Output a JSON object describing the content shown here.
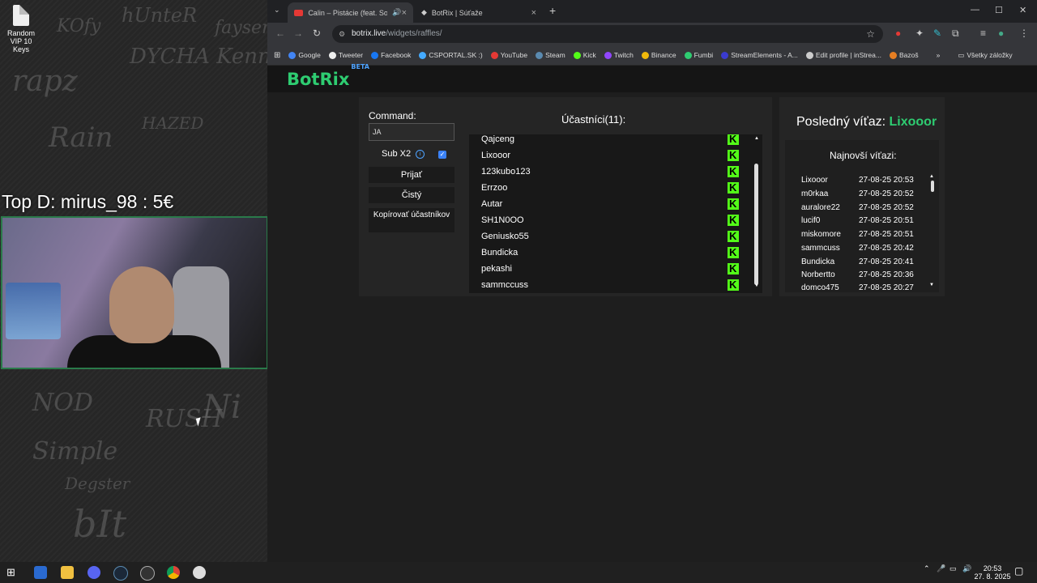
{
  "desktop": {
    "icon_label": "Random VIP 10 Keys",
    "overlay_text": "Top D: mirus_98 : 5€"
  },
  "browser": {
    "tabs": [
      {
        "label": "Calin – Pistácie (feat. Sofian",
        "active": false
      },
      {
        "label": "BotRix | Súťaže",
        "active": true
      }
    ],
    "address": {
      "domain": "botrix.live",
      "path": "/widgets/raffles/"
    },
    "bookmarks": [
      "Google",
      "Tweeter",
      "Facebook",
      "CSPORTAL.SK :)",
      "YouTube",
      "Steam",
      "Kick",
      "Twitch",
      "Binance",
      "Fumbi",
      "StreamElements - A...",
      "Edit profile | inStrea...",
      "Bazoš"
    ],
    "all_bookmarks": "Všetky záložky"
  },
  "botrix": {
    "logo": "BotRix",
    "badge": "BETA",
    "command_label": "Command:",
    "command_value": "JA",
    "sub_label": "Sub X2",
    "buttons": {
      "accept": "Prijať",
      "clear": "Čistý",
      "copy": "Kopírovať účastníkov"
    },
    "participants_title": "Účastníci(11):",
    "participants": [
      "Qajceng",
      "Lixooor",
      "123kubo123",
      "Errzoo",
      "Autar",
      "SH1N0OO",
      "Geniusko55",
      "Bundicka",
      "pekashi",
      "sammccuss"
    ],
    "last_winner_label": "Posledný víťaz:",
    "last_winner": "Lixooor",
    "recent_title": "Najnovší víťazi:",
    "winners": [
      {
        "name": "Lixooor",
        "date": "27-08-25 20:53"
      },
      {
        "name": "m0rkaa",
        "date": "27-08-25 20:52"
      },
      {
        "name": "auralore22",
        "date": "27-08-25 20:52"
      },
      {
        "name": "lucif0",
        "date": "27-08-25 20:51"
      },
      {
        "name": "miskomore",
        "date": "27-08-25 20:51"
      },
      {
        "name": "sammcuss",
        "date": "27-08-25 20:42"
      },
      {
        "name": "Bundicka",
        "date": "27-08-25 20:41"
      },
      {
        "name": "Norbertto",
        "date": "27-08-25 20:36"
      },
      {
        "name": "domco475",
        "date": "27-08-25 20:27"
      }
    ]
  },
  "taskbar": {
    "time": "20:53",
    "date": "27. 8. 2025"
  },
  "colors": {
    "accent": "#2ecc71",
    "kick": "#53fc18",
    "badge": "#4ea3ff"
  }
}
